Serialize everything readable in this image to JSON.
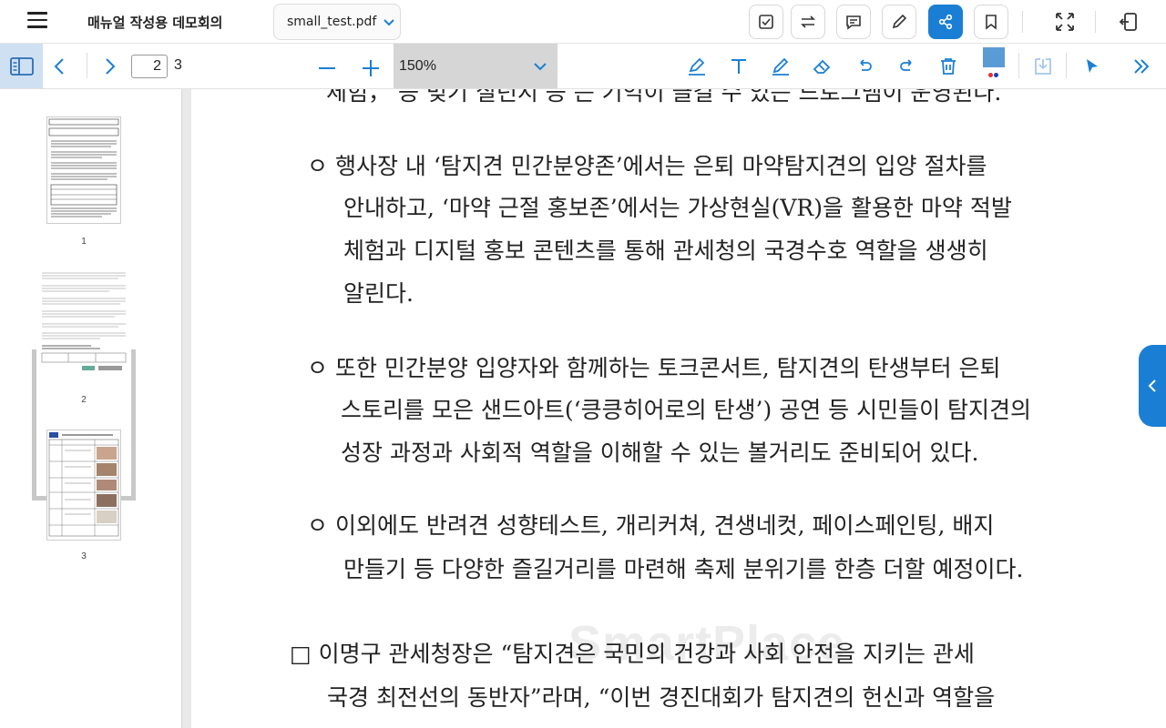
{
  "header": {
    "title": "매뉴얼 작성용 데모회의",
    "file_name": "small_test.pdf"
  },
  "toolbar": {
    "current_page": "2",
    "total_pages": "3",
    "zoom_level": "150%"
  },
  "sidebar": {
    "thumbnails": [
      {
        "label": "1"
      },
      {
        "label": "2"
      },
      {
        "label": "3"
      }
    ]
  },
  "document": {
    "lines": [
      "체험，  등  벚기  질년지  등  는  기억이  클길  수  있는  드로그맴이  운영된다.",
      "ㅇ  행사장  내  ‘탐지견  민간분양존’에서는  은퇴  마약탐지견의  입양  절차를",
      "안내하고,  ‘마약  근절  홍보존’에서는  가상현실(VR)을  활용한  마약  적발",
      "체험과  디지털  홍보  콘텐츠를  통해  관세청의  국경수호  역할을  생생히",
      "알린다.",
      "ㅇ  또한  민간분양  입양자와  함께하는  토크콘서트,  탐지견의  탄생부터  은퇴",
      "스토리를  모은  샌드아트(‘킁킁히어로의  탄생’)  공연  등  시민들이  탐지견의",
      "성장  과정과  사회적  역할을  이해할  수  있는  볼거리도  준비되어  있다.",
      "ㅇ  이외에도  반려견  성향테스트,  개리커쳐,  견생네컷,  페이스페인팅,  배지",
      "만들기  등  다양한  즐길거리를  마련해  축제  분위기를  한층  더할  예정이다.",
      "□  이명구  관세청장은  “탐지견은  국민의  건강과  사회  안전을  지키는  관세",
      "국경  최전선의  동반자”라며,  “이번  경진대회가  탐지견의  헌신과  역할을"
    ],
    "watermark": "SmartPlace"
  },
  "colors": {
    "accent": "#1a7fd4",
    "pen_color": "#5b9bd5"
  }
}
